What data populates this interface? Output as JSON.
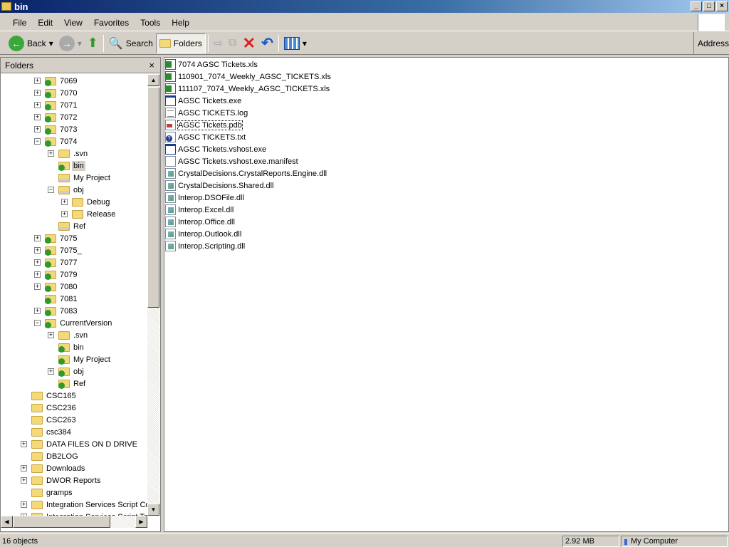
{
  "window": {
    "title": "bin",
    "min": "_",
    "max": "□",
    "close": "×"
  },
  "menu": [
    "File",
    "Edit",
    "View",
    "Favorites",
    "Tools",
    "Help"
  ],
  "toolbar": {
    "back": "Back",
    "search": "Search",
    "folders": "Folders",
    "address": "Address"
  },
  "folders_pane": {
    "title": "Folders",
    "close": "×"
  },
  "tree": [
    {
      "label": "7069",
      "level": 1,
      "exp": "+",
      "icon": "svn"
    },
    {
      "label": "7070",
      "level": 1,
      "exp": "+",
      "icon": "svn"
    },
    {
      "label": "7071",
      "level": 1,
      "exp": "+",
      "icon": "svn"
    },
    {
      "label": "7072",
      "level": 1,
      "exp": "+",
      "icon": "svn"
    },
    {
      "label": "7073",
      "level": 1,
      "exp": "+",
      "icon": "svn"
    },
    {
      "label": "7074",
      "level": 1,
      "exp": "-",
      "icon": "svn"
    },
    {
      "label": ".svn",
      "level": 2,
      "exp": "+",
      "icon": "plain"
    },
    {
      "label": "bin",
      "level": 2,
      "exp": "",
      "icon": "svn",
      "selected": true
    },
    {
      "label": "My Project",
      "level": 2,
      "exp": "",
      "icon": "gray"
    },
    {
      "label": "obj",
      "level": 2,
      "exp": "-",
      "icon": "gray"
    },
    {
      "label": "Debug",
      "level": 3,
      "exp": "+",
      "icon": "plain"
    },
    {
      "label": "Release",
      "level": 3,
      "exp": "+",
      "icon": "plain"
    },
    {
      "label": "Ref",
      "level": 2,
      "exp": "",
      "icon": "gray"
    },
    {
      "label": "7075",
      "level": 1,
      "exp": "+",
      "icon": "svn"
    },
    {
      "label": "7075_",
      "level": 1,
      "exp": "+",
      "icon": "svn"
    },
    {
      "label": "7077",
      "level": 1,
      "exp": "+",
      "icon": "svn"
    },
    {
      "label": "7079",
      "level": 1,
      "exp": "+",
      "icon": "svn"
    },
    {
      "label": "7080",
      "level": 1,
      "exp": "+",
      "icon": "svn"
    },
    {
      "label": "7081",
      "level": 1,
      "exp": "",
      "icon": "svn"
    },
    {
      "label": "7083",
      "level": 1,
      "exp": "+",
      "icon": "svn"
    },
    {
      "label": "CurrentVersion",
      "level": 1,
      "exp": "-",
      "icon": "svn"
    },
    {
      "label": ".svn",
      "level": 2,
      "exp": "+",
      "icon": "plain"
    },
    {
      "label": "bin",
      "level": 2,
      "exp": "",
      "icon": "svn"
    },
    {
      "label": "My Project",
      "level": 2,
      "exp": "",
      "icon": "svn"
    },
    {
      "label": "obj",
      "level": 2,
      "exp": "+",
      "icon": "svn"
    },
    {
      "label": "Ref",
      "level": 2,
      "exp": "",
      "icon": "svn"
    },
    {
      "label": "CSC165",
      "level": 0,
      "exp": "",
      "icon": "plain"
    },
    {
      "label": "CSC236",
      "level": 0,
      "exp": "",
      "icon": "plain"
    },
    {
      "label": "CSC263",
      "level": 0,
      "exp": "",
      "icon": "plain"
    },
    {
      "label": "csc384",
      "level": 0,
      "exp": "",
      "icon": "plain"
    },
    {
      "label": "DATA FILES ON D DRIVE",
      "level": 0,
      "exp": "+",
      "icon": "plain"
    },
    {
      "label": "DB2LOG",
      "level": 0,
      "exp": "",
      "icon": "plain"
    },
    {
      "label": "Downloads",
      "level": 0,
      "exp": "+",
      "icon": "plain"
    },
    {
      "label": "DWOR Reports",
      "level": 0,
      "exp": "+",
      "icon": "plain"
    },
    {
      "label": "gramps",
      "level": 0,
      "exp": "",
      "icon": "plain"
    },
    {
      "label": "Integration Services Script Co",
      "level": 0,
      "exp": "+",
      "icon": "plain"
    },
    {
      "label": "Integration Services Script Ta",
      "level": 0,
      "exp": "+",
      "icon": "plain"
    }
  ],
  "files": [
    {
      "name": "7074 AGSC Tickets.xls",
      "type": "xls"
    },
    {
      "name": "110901_7074_Weekly_AGSC_TICKETS.xls",
      "type": "xls"
    },
    {
      "name": "111107_7074_Weekly_AGSC_TICKETS.xls",
      "type": "xls"
    },
    {
      "name": "AGSC Tickets.exe",
      "type": "exe"
    },
    {
      "name": "AGSC TICKETS.log",
      "type": "log"
    },
    {
      "name": "AGSC Tickets.pdb",
      "type": "pdb",
      "focused": true
    },
    {
      "name": "AGSC TICKETS.txt",
      "type": "txt"
    },
    {
      "name": "AGSC Tickets.vshost.exe",
      "type": "vshost"
    },
    {
      "name": "AGSC Tickets.vshost.exe.manifest",
      "type": "manifest"
    },
    {
      "name": "CrystalDecisions.CrystalReports.Engine.dll",
      "type": "dll"
    },
    {
      "name": "CrystalDecisions.Shared.dll",
      "type": "dll"
    },
    {
      "name": "Interop.DSOFile.dll",
      "type": "dll"
    },
    {
      "name": "Interop.Excel.dll",
      "type": "dll"
    },
    {
      "name": "Interop.Office.dll",
      "type": "dll"
    },
    {
      "name": "Interop.Outlook.dll",
      "type": "dll"
    },
    {
      "name": "Interop.Scripting.dll",
      "type": "dll"
    }
  ],
  "status": {
    "objects": "16 objects",
    "size": "2.92 MB",
    "zone": "My Computer"
  }
}
